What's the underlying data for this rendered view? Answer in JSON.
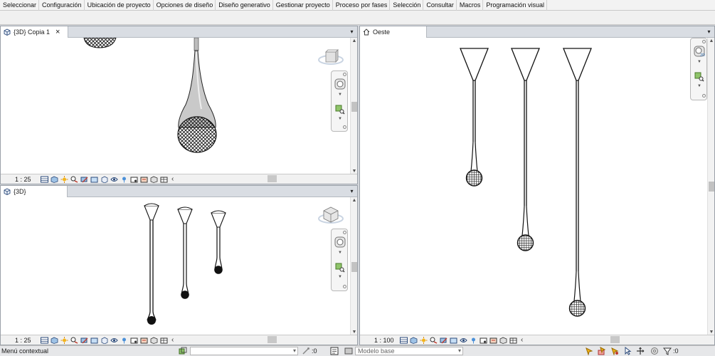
{
  "ribbon": {
    "tabs": [
      "Seleccionar",
      "Configuración",
      "Ubicación de proyecto",
      "Opciones de diseño",
      "Diseño generativo",
      "Gestionar proyecto",
      "Proceso por fases",
      "Selección",
      "Consultar",
      "Macros",
      "Programación visual"
    ]
  },
  "views": {
    "top_left": {
      "tab_label": "{3D} Copia 1",
      "close_glyph": "×",
      "scale": "1 : 25",
      "icon": "3d-view-icon"
    },
    "bottom_left": {
      "tab_label": "{3D}",
      "scale": "1 : 25",
      "icon": "3d-view-icon"
    },
    "right": {
      "tab_label": "Oeste",
      "scale": "1 : 100",
      "icon": "elevation-view-icon"
    }
  },
  "view_menu_glyph": "▾",
  "statusbar_chevron": "‹",
  "app_status": {
    "message": "Menú contextual",
    "workset_value": ":0",
    "design_option_value": "Modelo base",
    "filter_count": ":0"
  }
}
